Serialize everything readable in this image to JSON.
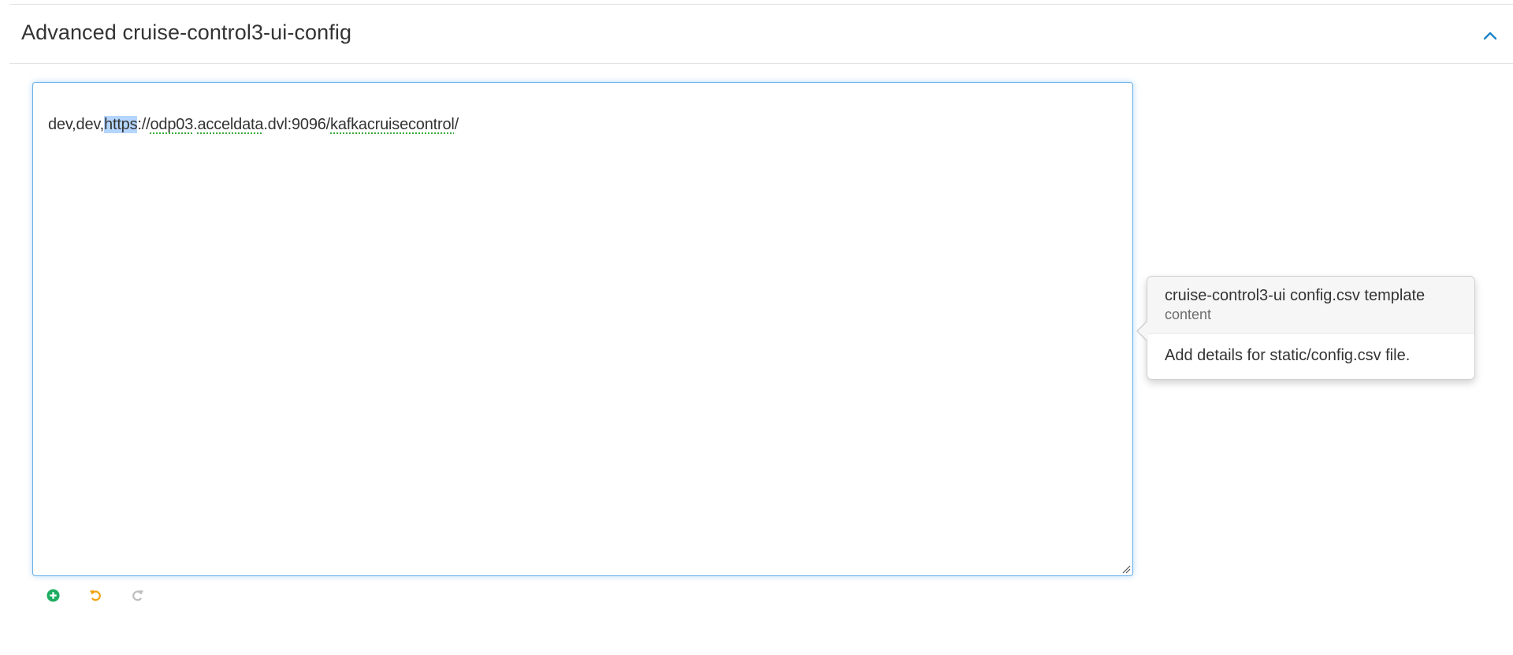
{
  "section": {
    "title": "Advanced cruise-control3-ui-config"
  },
  "editor": {
    "text_before": "dev,dev,",
    "selected": "https",
    "text_after_1": "://",
    "spell_1": "odp03",
    "dot_1": ".",
    "spell_2": "acceldata",
    "text_after_2": ".dvl:9096/",
    "spell_3": "kafkacruisecontrol",
    "text_end": "/"
  },
  "popover": {
    "title": "cruise-control3-ui config.csv template",
    "subtitle": "content",
    "body": "Add details for static/config.csv file."
  },
  "colors": {
    "accent": "#1b85c7",
    "add": "#1fad61",
    "undo": "#f0a10c",
    "redo": "#bdbdbd",
    "focus_border": "#66afe9"
  },
  "icons": {
    "collapse": "chevron-up-icon",
    "add": "plus-circle-icon",
    "undo": "undo-icon",
    "redo": "redo-icon"
  }
}
